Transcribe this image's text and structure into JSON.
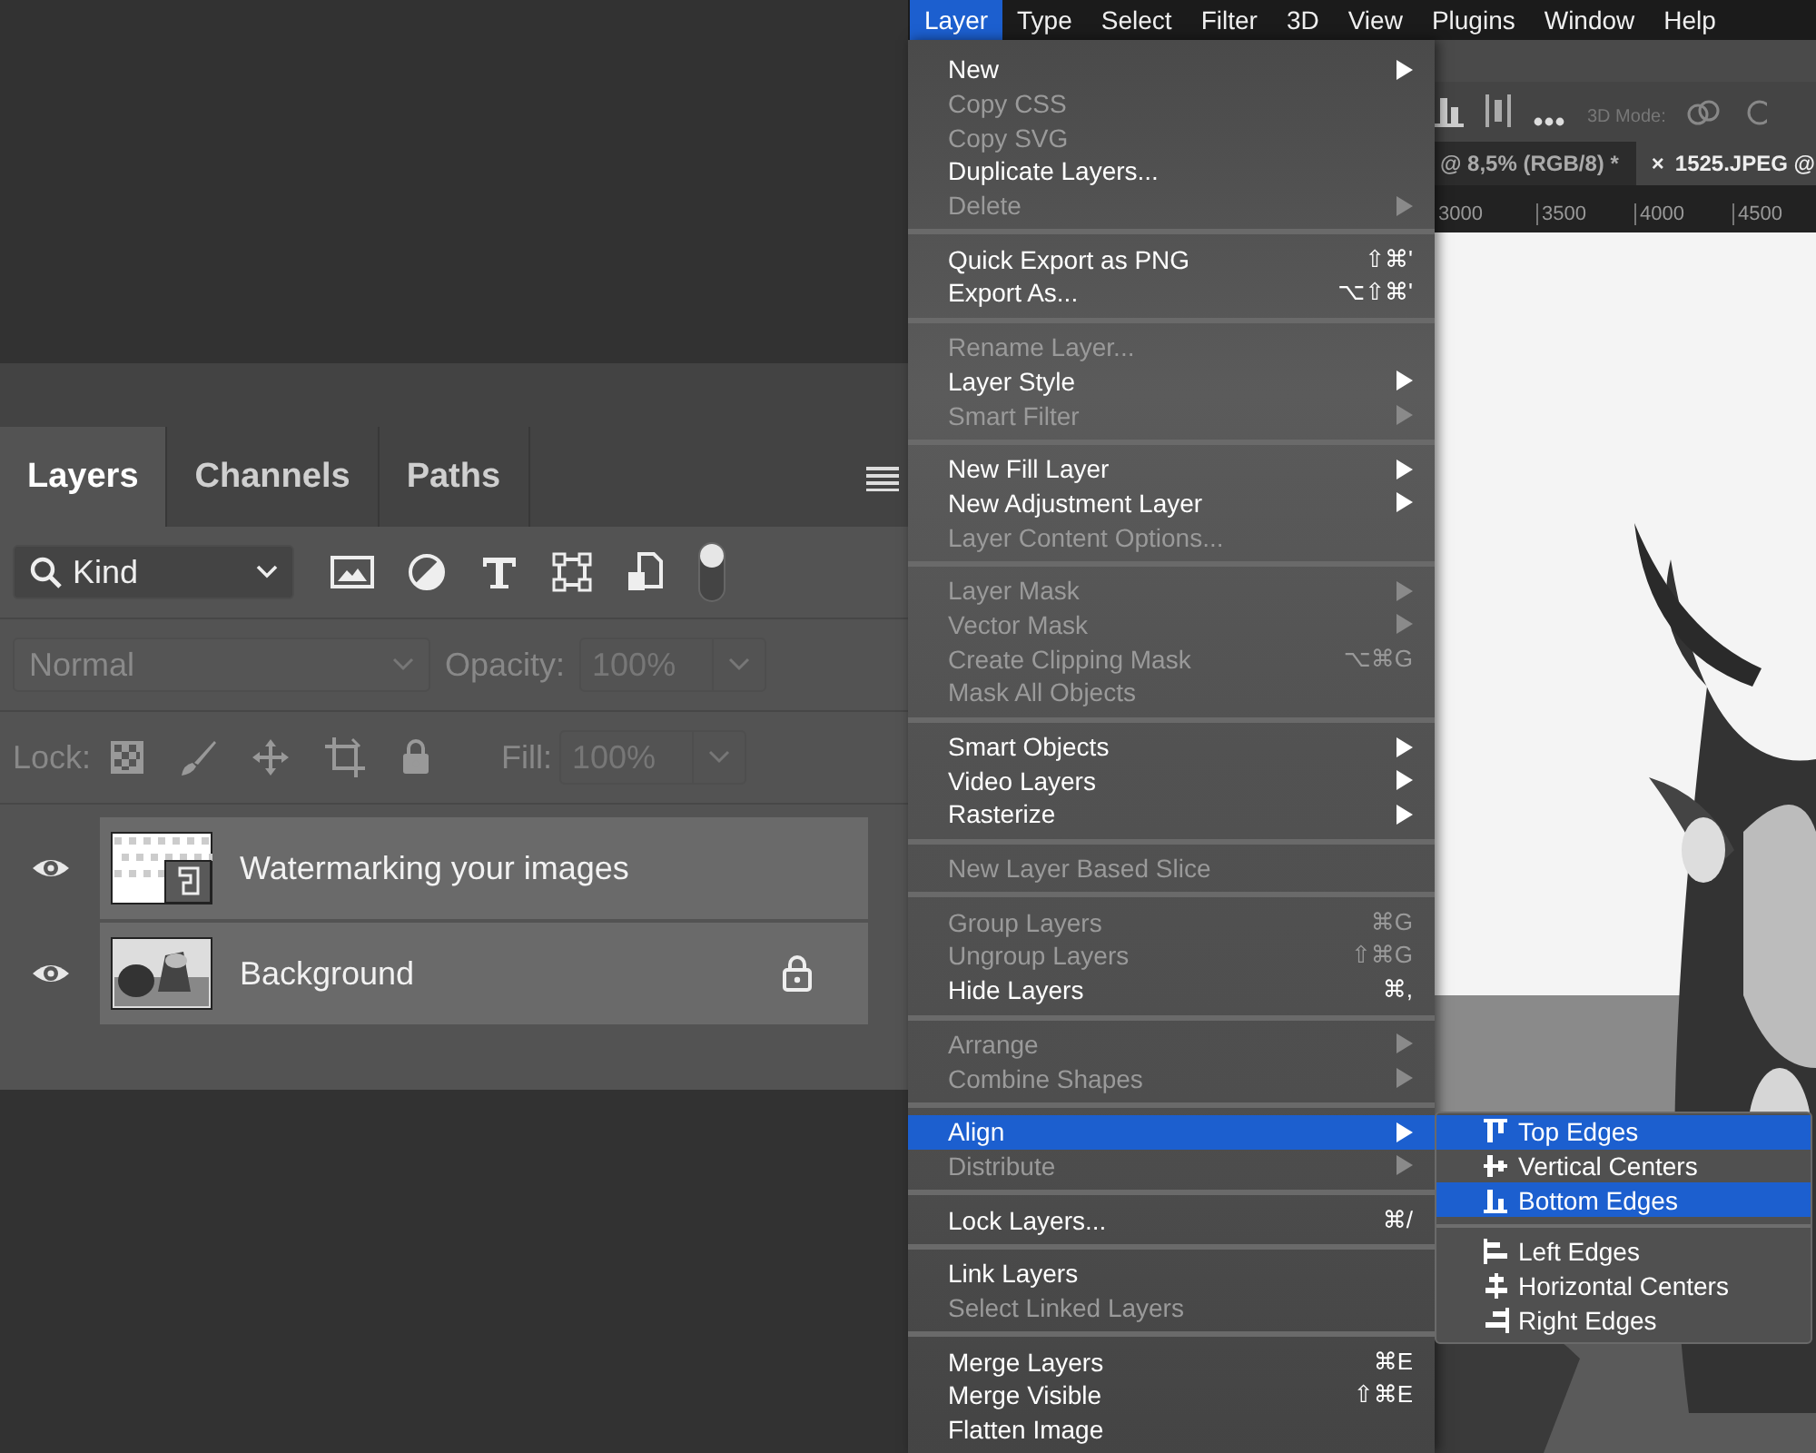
{
  "layers_panel": {
    "tabs": [
      {
        "label": "Layers",
        "selected": true
      },
      {
        "label": "Channels",
        "selected": false
      },
      {
        "label": "Paths",
        "selected": false
      }
    ],
    "filter": {
      "value": "Kind",
      "toggle_on": true
    },
    "blend_mode": {
      "value": "Normal",
      "disabled": true
    },
    "opacity": {
      "label": "Opacity:",
      "value": "100%",
      "disabled": true
    },
    "lock_label": "Lock:",
    "fill": {
      "label": "Fill:",
      "value": "100%",
      "disabled": true
    },
    "layers": [
      {
        "name": "Watermarking your images",
        "visible": true,
        "locked": false,
        "kind": "smart_object"
      },
      {
        "name": "Background",
        "visible": true,
        "locked": true,
        "kind": "picture"
      }
    ]
  },
  "menubar": [
    {
      "label": "Layer",
      "selected": true
    },
    {
      "label": "Type",
      "selected": false
    },
    {
      "label": "Select",
      "selected": false
    },
    {
      "label": "Filter",
      "selected": false
    },
    {
      "label": "3D",
      "selected": false
    },
    {
      "label": "View",
      "selected": false
    },
    {
      "label": "Plugins",
      "selected": false
    },
    {
      "label": "Window",
      "selected": false
    },
    {
      "label": "Help",
      "selected": false
    }
  ],
  "workspace": {
    "options_label": "3D Mode:",
    "tabs": [
      {
        "label": "@ 8,5% (RGB/8) *"
      },
      {
        "close": "×",
        "label": "1525.JPEG @"
      }
    ],
    "ruler": [
      "3000",
      "3500",
      "4000",
      "4500"
    ],
    "canvas": {
      "kind": "picture"
    }
  },
  "layer_menu": [
    [
      {
        "label": "New",
        "disabled": false,
        "submenu": true,
        "selected": false
      },
      {
        "label": "Copy CSS",
        "disabled": true,
        "submenu": false,
        "selected": false
      },
      {
        "label": "Copy SVG",
        "disabled": true,
        "submenu": false,
        "selected": false
      },
      {
        "label": "Duplicate Layers...",
        "disabled": false,
        "submenu": false,
        "selected": false
      },
      {
        "label": "Delete",
        "disabled": true,
        "submenu": true,
        "selected": false
      }
    ],
    [
      {
        "label": "Quick Export as PNG",
        "disabled": false,
        "submenu": false,
        "selected": false,
        "shortcut": "⇧⌘'"
      },
      {
        "label": "Export As...",
        "disabled": false,
        "submenu": false,
        "selected": false,
        "shortcut": "⌥⇧⌘'"
      }
    ],
    [
      {
        "label": "Rename Layer...",
        "disabled": true,
        "submenu": false,
        "selected": false
      },
      {
        "label": "Layer Style",
        "disabled": false,
        "submenu": true,
        "selected": false
      },
      {
        "label": "Smart Filter",
        "disabled": true,
        "submenu": true,
        "selected": false
      }
    ],
    [
      {
        "label": "New Fill Layer",
        "disabled": false,
        "submenu": true,
        "selected": false
      },
      {
        "label": "New Adjustment Layer",
        "disabled": false,
        "submenu": true,
        "selected": false
      },
      {
        "label": "Layer Content Options...",
        "disabled": true,
        "submenu": false,
        "selected": false
      }
    ],
    [
      {
        "label": "Layer Mask",
        "disabled": true,
        "submenu": true,
        "selected": false
      },
      {
        "label": "Vector Mask",
        "disabled": true,
        "submenu": true,
        "selected": false
      },
      {
        "label": "Create Clipping Mask",
        "disabled": true,
        "submenu": false,
        "selected": false,
        "shortcut": "⌥⌘G"
      },
      {
        "label": "Mask All Objects",
        "disabled": true,
        "submenu": false,
        "selected": false
      }
    ],
    [
      {
        "label": "Smart Objects",
        "disabled": false,
        "submenu": true,
        "selected": false
      },
      {
        "label": "Video Layers",
        "disabled": false,
        "submenu": true,
        "selected": false
      },
      {
        "label": "Rasterize",
        "disabled": false,
        "submenu": true,
        "selected": false
      }
    ],
    [
      {
        "label": "New Layer Based Slice",
        "disabled": true,
        "submenu": false,
        "selected": false
      }
    ],
    [
      {
        "label": "Group Layers",
        "disabled": true,
        "submenu": false,
        "selected": false,
        "shortcut": "⌘G"
      },
      {
        "label": "Ungroup Layers",
        "disabled": true,
        "submenu": false,
        "selected": false,
        "shortcut": "⇧⌘G"
      },
      {
        "label": "Hide Layers",
        "disabled": false,
        "submenu": false,
        "selected": false,
        "shortcut": "⌘,"
      }
    ],
    [
      {
        "label": "Arrange",
        "disabled": true,
        "submenu": true,
        "selected": false
      },
      {
        "label": "Combine Shapes",
        "disabled": true,
        "submenu": true,
        "selected": false
      }
    ],
    [
      {
        "label": "Align",
        "disabled": false,
        "submenu": true,
        "selected": true
      },
      {
        "label": "Distribute",
        "disabled": true,
        "submenu": true,
        "selected": false
      }
    ],
    [
      {
        "label": "Lock Layers...",
        "disabled": false,
        "submenu": false,
        "selected": false,
        "shortcut": "⌘/"
      }
    ],
    [
      {
        "label": "Link Layers",
        "disabled": false,
        "submenu": false,
        "selected": false
      },
      {
        "label": "Select Linked Layers",
        "disabled": true,
        "submenu": false,
        "selected": false
      }
    ],
    [
      {
        "label": "Merge Layers",
        "disabled": false,
        "submenu": false,
        "selected": false,
        "shortcut": "⌘E"
      },
      {
        "label": "Merge Visible",
        "disabled": false,
        "submenu": false,
        "selected": false,
        "shortcut": "⇧⌘E"
      },
      {
        "label": "Flatten Image",
        "disabled": false,
        "submenu": false,
        "selected": false
      }
    ]
  ],
  "align_submenu": [
    [
      {
        "kind": "top",
        "label": "Top Edges",
        "selected": true
      },
      {
        "kind": "vcenter",
        "label": "Vertical Centers",
        "selected": false
      },
      {
        "kind": "bottom",
        "label": "Bottom Edges",
        "selected": true
      }
    ],
    [
      {
        "kind": "left",
        "label": "Left Edges",
        "selected": false
      },
      {
        "kind": "hcenter",
        "label": "Horizontal Centers",
        "selected": false
      },
      {
        "kind": "right",
        "label": "Right Edges",
        "selected": false
      }
    ]
  ]
}
